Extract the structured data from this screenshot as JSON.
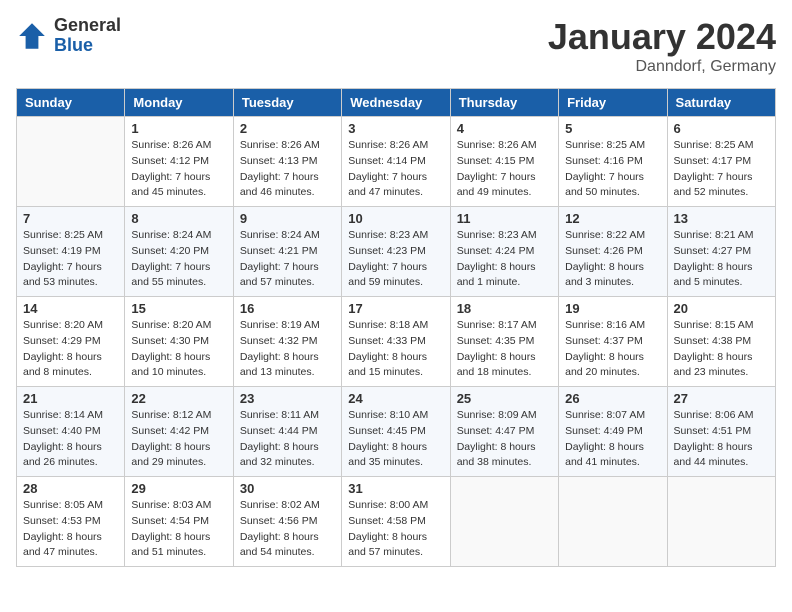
{
  "header": {
    "logo_general": "General",
    "logo_blue": "Blue",
    "month_title": "January 2024",
    "location": "Danndorf, Germany"
  },
  "weekdays": [
    "Sunday",
    "Monday",
    "Tuesday",
    "Wednesday",
    "Thursday",
    "Friday",
    "Saturday"
  ],
  "weeks": [
    [
      {
        "day": "",
        "sunrise": "",
        "sunset": "",
        "daylight": ""
      },
      {
        "day": "1",
        "sunrise": "Sunrise: 8:26 AM",
        "sunset": "Sunset: 4:12 PM",
        "daylight": "Daylight: 7 hours and 45 minutes."
      },
      {
        "day": "2",
        "sunrise": "Sunrise: 8:26 AM",
        "sunset": "Sunset: 4:13 PM",
        "daylight": "Daylight: 7 hours and 46 minutes."
      },
      {
        "day": "3",
        "sunrise": "Sunrise: 8:26 AM",
        "sunset": "Sunset: 4:14 PM",
        "daylight": "Daylight: 7 hours and 47 minutes."
      },
      {
        "day": "4",
        "sunrise": "Sunrise: 8:26 AM",
        "sunset": "Sunset: 4:15 PM",
        "daylight": "Daylight: 7 hours and 49 minutes."
      },
      {
        "day": "5",
        "sunrise": "Sunrise: 8:25 AM",
        "sunset": "Sunset: 4:16 PM",
        "daylight": "Daylight: 7 hours and 50 minutes."
      },
      {
        "day": "6",
        "sunrise": "Sunrise: 8:25 AM",
        "sunset": "Sunset: 4:17 PM",
        "daylight": "Daylight: 7 hours and 52 minutes."
      }
    ],
    [
      {
        "day": "7",
        "sunrise": "Sunrise: 8:25 AM",
        "sunset": "Sunset: 4:19 PM",
        "daylight": "Daylight: 7 hours and 53 minutes."
      },
      {
        "day": "8",
        "sunrise": "Sunrise: 8:24 AM",
        "sunset": "Sunset: 4:20 PM",
        "daylight": "Daylight: 7 hours and 55 minutes."
      },
      {
        "day": "9",
        "sunrise": "Sunrise: 8:24 AM",
        "sunset": "Sunset: 4:21 PM",
        "daylight": "Daylight: 7 hours and 57 minutes."
      },
      {
        "day": "10",
        "sunrise": "Sunrise: 8:23 AM",
        "sunset": "Sunset: 4:23 PM",
        "daylight": "Daylight: 7 hours and 59 minutes."
      },
      {
        "day": "11",
        "sunrise": "Sunrise: 8:23 AM",
        "sunset": "Sunset: 4:24 PM",
        "daylight": "Daylight: 8 hours and 1 minute."
      },
      {
        "day": "12",
        "sunrise": "Sunrise: 8:22 AM",
        "sunset": "Sunset: 4:26 PM",
        "daylight": "Daylight: 8 hours and 3 minutes."
      },
      {
        "day": "13",
        "sunrise": "Sunrise: 8:21 AM",
        "sunset": "Sunset: 4:27 PM",
        "daylight": "Daylight: 8 hours and 5 minutes."
      }
    ],
    [
      {
        "day": "14",
        "sunrise": "Sunrise: 8:20 AM",
        "sunset": "Sunset: 4:29 PM",
        "daylight": "Daylight: 8 hours and 8 minutes."
      },
      {
        "day": "15",
        "sunrise": "Sunrise: 8:20 AM",
        "sunset": "Sunset: 4:30 PM",
        "daylight": "Daylight: 8 hours and 10 minutes."
      },
      {
        "day": "16",
        "sunrise": "Sunrise: 8:19 AM",
        "sunset": "Sunset: 4:32 PM",
        "daylight": "Daylight: 8 hours and 13 minutes."
      },
      {
        "day": "17",
        "sunrise": "Sunrise: 8:18 AM",
        "sunset": "Sunset: 4:33 PM",
        "daylight": "Daylight: 8 hours and 15 minutes."
      },
      {
        "day": "18",
        "sunrise": "Sunrise: 8:17 AM",
        "sunset": "Sunset: 4:35 PM",
        "daylight": "Daylight: 8 hours and 18 minutes."
      },
      {
        "day": "19",
        "sunrise": "Sunrise: 8:16 AM",
        "sunset": "Sunset: 4:37 PM",
        "daylight": "Daylight: 8 hours and 20 minutes."
      },
      {
        "day": "20",
        "sunrise": "Sunrise: 8:15 AM",
        "sunset": "Sunset: 4:38 PM",
        "daylight": "Daylight: 8 hours and 23 minutes."
      }
    ],
    [
      {
        "day": "21",
        "sunrise": "Sunrise: 8:14 AM",
        "sunset": "Sunset: 4:40 PM",
        "daylight": "Daylight: 8 hours and 26 minutes."
      },
      {
        "day": "22",
        "sunrise": "Sunrise: 8:12 AM",
        "sunset": "Sunset: 4:42 PM",
        "daylight": "Daylight: 8 hours and 29 minutes."
      },
      {
        "day": "23",
        "sunrise": "Sunrise: 8:11 AM",
        "sunset": "Sunset: 4:44 PM",
        "daylight": "Daylight: 8 hours and 32 minutes."
      },
      {
        "day": "24",
        "sunrise": "Sunrise: 8:10 AM",
        "sunset": "Sunset: 4:45 PM",
        "daylight": "Daylight: 8 hours and 35 minutes."
      },
      {
        "day": "25",
        "sunrise": "Sunrise: 8:09 AM",
        "sunset": "Sunset: 4:47 PM",
        "daylight": "Daylight: 8 hours and 38 minutes."
      },
      {
        "day": "26",
        "sunrise": "Sunrise: 8:07 AM",
        "sunset": "Sunset: 4:49 PM",
        "daylight": "Daylight: 8 hours and 41 minutes."
      },
      {
        "day": "27",
        "sunrise": "Sunrise: 8:06 AM",
        "sunset": "Sunset: 4:51 PM",
        "daylight": "Daylight: 8 hours and 44 minutes."
      }
    ],
    [
      {
        "day": "28",
        "sunrise": "Sunrise: 8:05 AM",
        "sunset": "Sunset: 4:53 PM",
        "daylight": "Daylight: 8 hours and 47 minutes."
      },
      {
        "day": "29",
        "sunrise": "Sunrise: 8:03 AM",
        "sunset": "Sunset: 4:54 PM",
        "daylight": "Daylight: 8 hours and 51 minutes."
      },
      {
        "day": "30",
        "sunrise": "Sunrise: 8:02 AM",
        "sunset": "Sunset: 4:56 PM",
        "daylight": "Daylight: 8 hours and 54 minutes."
      },
      {
        "day": "31",
        "sunrise": "Sunrise: 8:00 AM",
        "sunset": "Sunset: 4:58 PM",
        "daylight": "Daylight: 8 hours and 57 minutes."
      },
      {
        "day": "",
        "sunrise": "",
        "sunset": "",
        "daylight": ""
      },
      {
        "day": "",
        "sunrise": "",
        "sunset": "",
        "daylight": ""
      },
      {
        "day": "",
        "sunrise": "",
        "sunset": "",
        "daylight": ""
      }
    ]
  ]
}
